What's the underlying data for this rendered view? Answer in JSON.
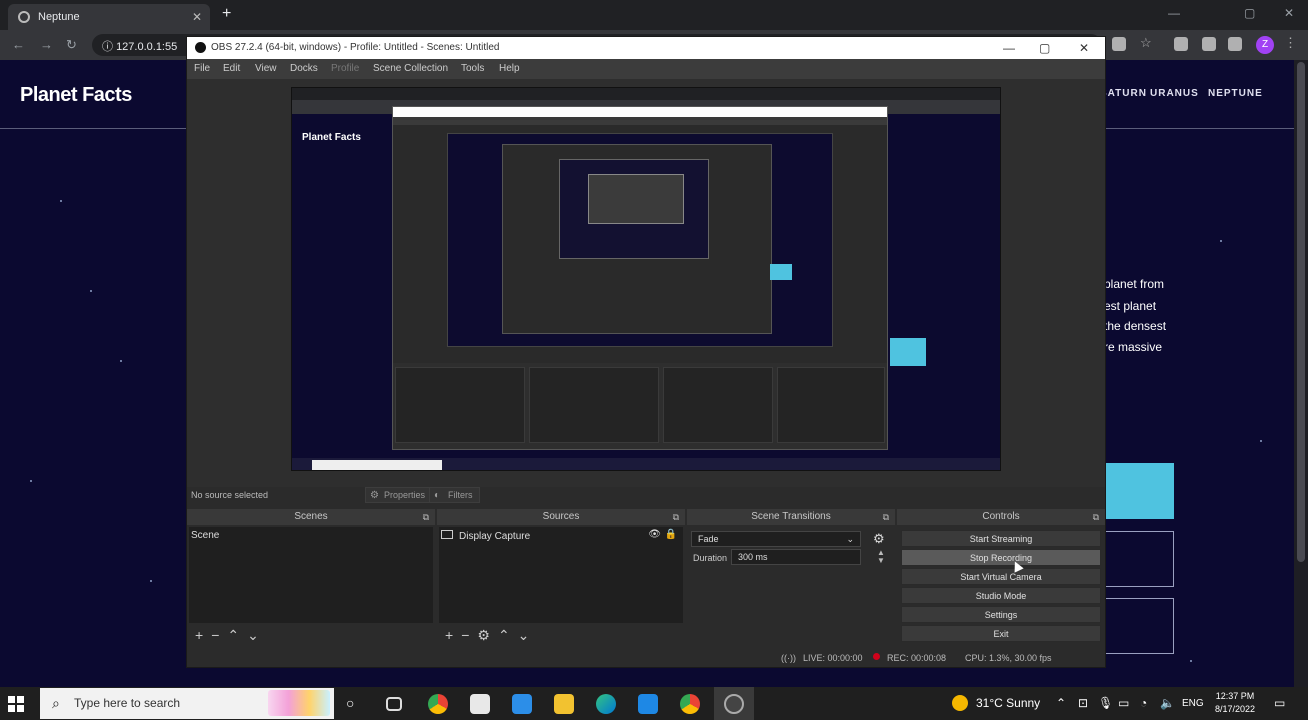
{
  "browser": {
    "tab_title": "Neptune",
    "new_tab": "+",
    "address": "127.0.0.1:55"
  },
  "website": {
    "logo": "Planet Facts",
    "nav": [
      "SATURN",
      "URANUS",
      "NEPTUNE"
    ],
    "text_lines": [
      "planet from",
      "est planet",
      "the densest",
      "re massive"
    ],
    "accent": "#4fc3e0"
  },
  "obs": {
    "title": "OBS 27.2.4 (64-bit, windows) - Profile: Untitled - Scenes: Untitled",
    "menu": [
      "File",
      "Edit",
      "View",
      "Docks",
      "Profile",
      "Scene Collection",
      "Tools",
      "Help"
    ],
    "no_source": "No source selected",
    "properties_label": "Properties",
    "filters_label": "Filters",
    "docks": {
      "scenes": {
        "title": "Scenes",
        "items": [
          "Scene"
        ]
      },
      "sources": {
        "title": "Sources",
        "items": [
          "Display Capture"
        ]
      },
      "transitions": {
        "title": "Scene Transitions",
        "selected": "Fade",
        "duration_label": "Duration",
        "duration_value": "300 ms"
      },
      "controls": {
        "title": "Controls",
        "buttons": [
          "Start Streaming",
          "Stop Recording",
          "Start Virtual Camera",
          "Studio Mode",
          "Settings",
          "Exit"
        ]
      }
    },
    "status": {
      "live": "LIVE: 00:00:00",
      "rec": "REC: 00:00:08",
      "cpu": "CPU: 1.3%, 30.00 fps"
    }
  },
  "taskbar": {
    "search_placeholder": "Type here to search",
    "weather": "31°C  Sunny",
    "lang": "ENG",
    "time": "12:37 PM",
    "date": "8/17/2022"
  }
}
